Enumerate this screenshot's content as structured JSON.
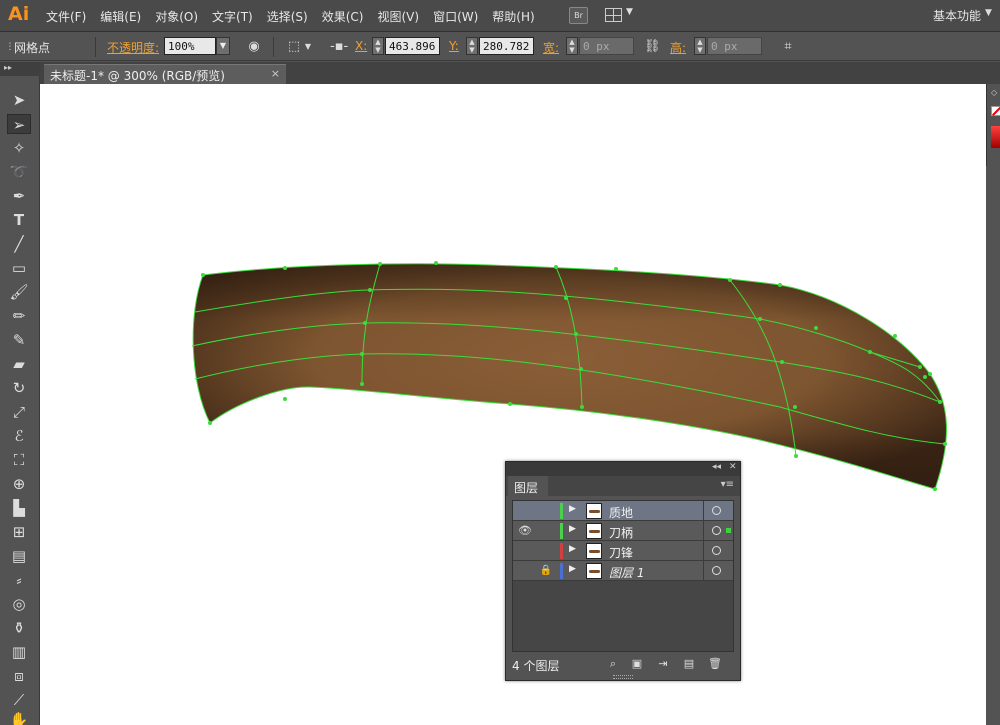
{
  "app": {
    "logo": "Ai",
    "menu": [
      "文件(F)",
      "编辑(E)",
      "对象(O)",
      "文字(T)",
      "选择(S)",
      "效果(C)",
      "视图(V)",
      "窗口(W)",
      "帮助(H)"
    ],
    "bridge_label": "Br",
    "workspace": "基本功能"
  },
  "control_bar": {
    "selection_type": "网格点",
    "opacity_label": "不透明度:",
    "opacity_value": "100%",
    "x_label": "X:",
    "x_value": "463.896",
    "y_label": "Y:",
    "y_value": "280.782",
    "width_label": "宽:",
    "width_value": "0 px",
    "height_label": "高:",
    "height_value": "0 px"
  },
  "document_tab": {
    "title": "未标题-1* @ 300% (RGB/预览)",
    "close": "×"
  },
  "layers_panel": {
    "tab": "图层",
    "count_label": "4 个图层",
    "layers": [
      {
        "name": "质地",
        "color": "#4ccf4c",
        "visible": false,
        "locked": false,
        "selected": true
      },
      {
        "name": "刀柄",
        "color": "#4ccf4c",
        "visible": true,
        "locked": false,
        "selected": false
      },
      {
        "name": "刀锋",
        "color": "#d04040",
        "visible": false,
        "locked": false,
        "selected": false
      },
      {
        "name": "图层 1",
        "color": "#4c6fd0",
        "visible": false,
        "locked": true,
        "selected": false
      }
    ]
  },
  "colors": {
    "mesh_line": "#3cdc3c",
    "handle_light": "#8a5e37",
    "handle_dark": "#3a2414",
    "accent": "#f0a030"
  }
}
